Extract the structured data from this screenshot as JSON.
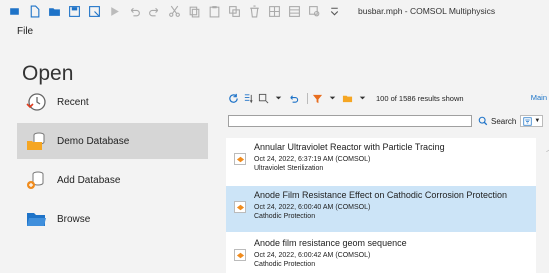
{
  "app": {
    "document_title": "busbar.mph - COMSOL Multiphysics"
  },
  "ribbon": {
    "file_tab": "File"
  },
  "backstage": {
    "title": "Open",
    "nav": [
      {
        "label": "Recent",
        "icon": "recent-icon"
      },
      {
        "label": "Demo Database",
        "icon": "database-folder-icon",
        "selected": true
      },
      {
        "label": "Add Database",
        "icon": "add-database-icon"
      },
      {
        "label": "Browse",
        "icon": "folder-icon"
      }
    ]
  },
  "results": {
    "count_text": "100 of 1586 results shown",
    "main_link": "Main",
    "search_value": "",
    "search_button": "Search",
    "entries": [
      {
        "name": "Annular Ultraviolet Reactor with Particle Tracing",
        "date": "Oct 24, 2022, 6:37:19 AM (COMSOL)",
        "category": "Ultraviolet Sterilization"
      },
      {
        "name": "Anode Film Resistance Effect on Cathodic Corrosion Protection",
        "date": "Oct 24, 2022, 6:00:40 AM (COMSOL)",
        "category": "Cathodic Protection",
        "selected": true
      },
      {
        "name": "Anode film resistance geom sequence",
        "date": "Oct 24, 2022, 6:00:42 AM (COMSOL)",
        "category": "Cathodic Protection"
      }
    ]
  },
  "colors": {
    "selected_nav": "#d6d6d6",
    "selected_entry": "#cce4f7",
    "accent": "#1a73c8",
    "folder": "#1e73c8",
    "thumb_orange": "#f08c1e"
  }
}
